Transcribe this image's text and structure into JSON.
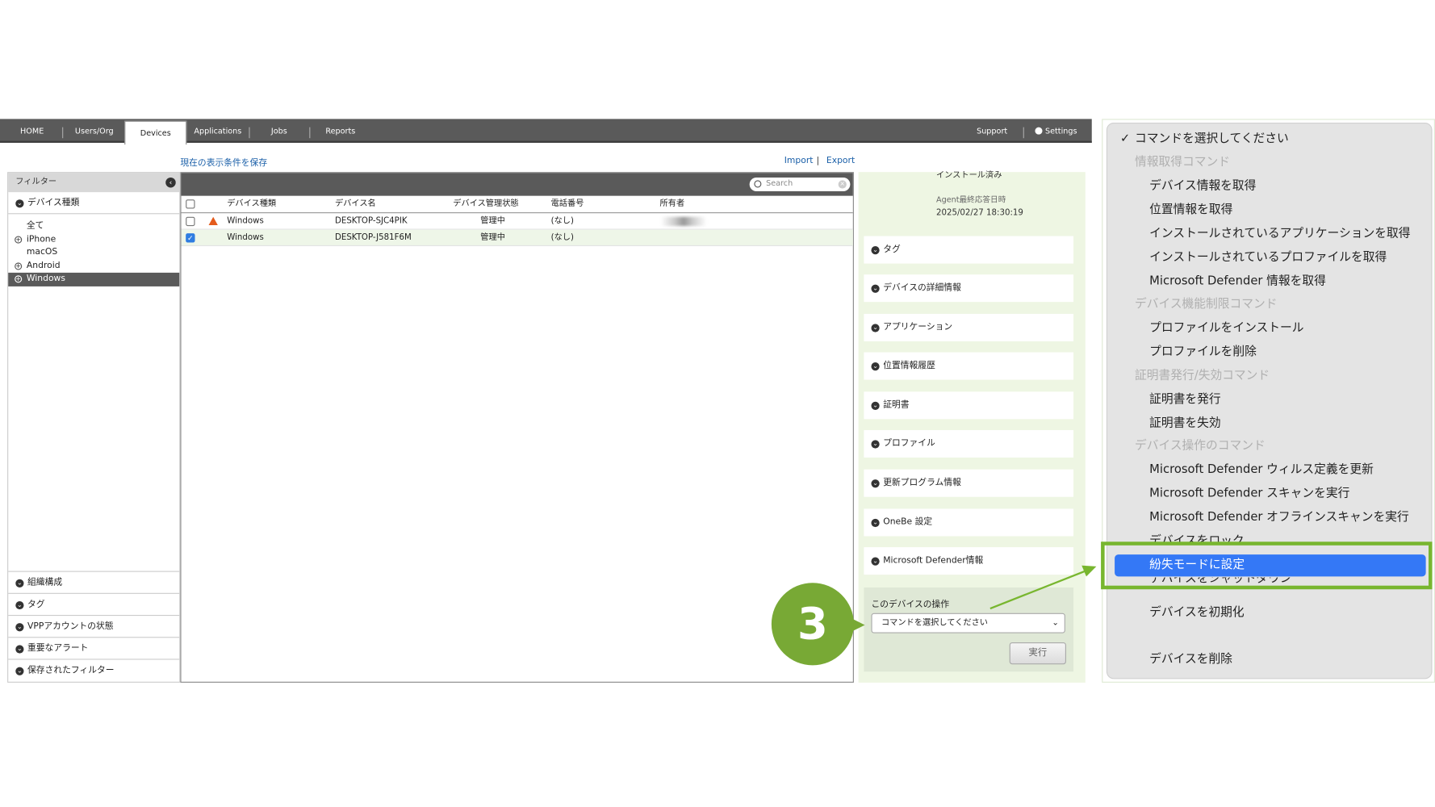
{
  "nav": {
    "tabs": [
      "HOME",
      "Users/Org",
      "Devices",
      "Applications",
      "Jobs",
      "Reports"
    ],
    "active_tab": "Devices",
    "support": "Support",
    "settings": "Settings"
  },
  "links": {
    "save_view": "現在の表示条件を保存",
    "import": "Import",
    "separator": "|",
    "export": "Export"
  },
  "filter": {
    "title": "フィルター",
    "device_type_section": "デバイス種類",
    "device_types": [
      "全て",
      "iPhone",
      "macOS",
      "Android",
      "Windows"
    ],
    "selected_type": "Windows",
    "bottom_sections": [
      "組織構成",
      "タグ",
      "VPPアカウントの状態",
      "重要なアラート",
      "保存されたフィルター"
    ]
  },
  "table": {
    "search_placeholder": "Search",
    "columns": [
      "デバイス種類",
      "デバイス名",
      "デバイス管理状態",
      "電話番号",
      "所有者"
    ],
    "rows": [
      {
        "type": "Windows",
        "name": "DESKTOP-SJC4PIK",
        "status": "管理中",
        "phone": "(なし)",
        "checked": false,
        "warning": true
      },
      {
        "type": "Windows",
        "name": "DESKTOP-J581F6M",
        "status": "管理中",
        "phone": "(なし)",
        "checked": true,
        "warning": false
      }
    ]
  },
  "detail": {
    "install_status": "インストール済み",
    "last_response_label": "Agent最終応答日時",
    "last_response_value": "2025/02/27 18:30:19",
    "sections": [
      "タグ",
      "デバイスの詳細情報",
      "アプリケーション",
      "位置情報履歴",
      "証明書",
      "プロファイル",
      "更新プログラム情報",
      "OneBe 設定",
      "Microsoft Defender情報"
    ],
    "ops_title": "このデバイスの操作",
    "ops_select": "コマンドを選択してください",
    "run_button": "実行"
  },
  "step_badge": "3",
  "menu": {
    "selected": "コマンドを選択してください",
    "items": [
      {
        "kind": "group",
        "label": "情報取得コマンド"
      },
      {
        "kind": "cmd",
        "label": "デバイス情報を取得"
      },
      {
        "kind": "cmd",
        "label": "位置情報を取得"
      },
      {
        "kind": "cmd",
        "label": "インストールされているアプリケーションを取得"
      },
      {
        "kind": "cmd",
        "label": "インストールされているプロファイルを取得"
      },
      {
        "kind": "cmd",
        "label": "Microsoft Defender 情報を取得"
      },
      {
        "kind": "group",
        "label": "デバイス機能制限コマンド"
      },
      {
        "kind": "cmd",
        "label": "プロファイルをインストール"
      },
      {
        "kind": "cmd",
        "label": "プロファイルを削除"
      },
      {
        "kind": "group",
        "label": "証明書発行/失効コマンド"
      },
      {
        "kind": "cmd",
        "label": "証明書を発行"
      },
      {
        "kind": "cmd",
        "label": "証明書を失効"
      },
      {
        "kind": "group",
        "label": "デバイス操作のコマンド"
      },
      {
        "kind": "cmd",
        "label": "Microsoft Defender ウィルス定義を更新"
      },
      {
        "kind": "cmd",
        "label": "Microsoft Defender スキャンを実行"
      },
      {
        "kind": "cmd",
        "label": "Microsoft Defender オフラインスキャンを実行"
      },
      {
        "kind": "cmd",
        "label": "デバイスをロック"
      },
      {
        "kind": "highlight",
        "label": "紛失モードに設定"
      },
      {
        "kind": "cmd",
        "label": "デバイスをシャットダウン"
      },
      {
        "kind": "cmd",
        "label": "デバイスを初期化"
      },
      {
        "kind": "cmd",
        "label": ""
      },
      {
        "kind": "cmd",
        "label": "デバイスを削除"
      }
    ]
  },
  "colors": {
    "nav_bg": "#5a5a5a",
    "accent_green": "#78a935",
    "menu_highlight": "#3478f6",
    "link": "#1a5fa8"
  }
}
